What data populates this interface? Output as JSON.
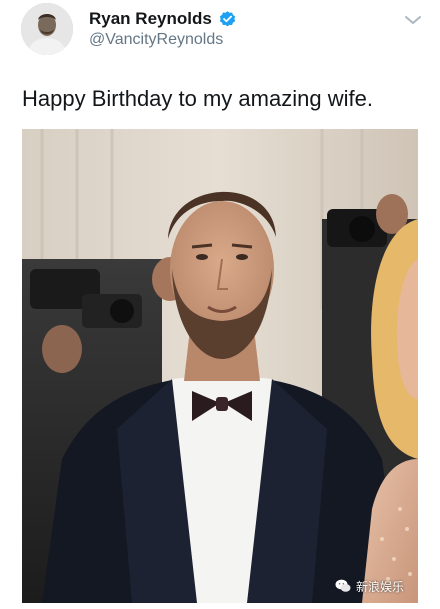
{
  "tweet": {
    "author": {
      "display_name": "Ryan Reynolds",
      "handle": "@VancityReynolds",
      "verified": true,
      "avatar_icon": "profile-photo"
    },
    "more_icon": "chevron-down-icon",
    "text": "Happy Birthday to my amazing wife.",
    "media": {
      "description_icon": "photo",
      "watermark_text": "新浪娱乐"
    }
  },
  "colors": {
    "primary_text": "#14171a",
    "secondary_text": "#657786",
    "verified_blue": "#1da1f2",
    "chevron": "#aab8c2"
  }
}
